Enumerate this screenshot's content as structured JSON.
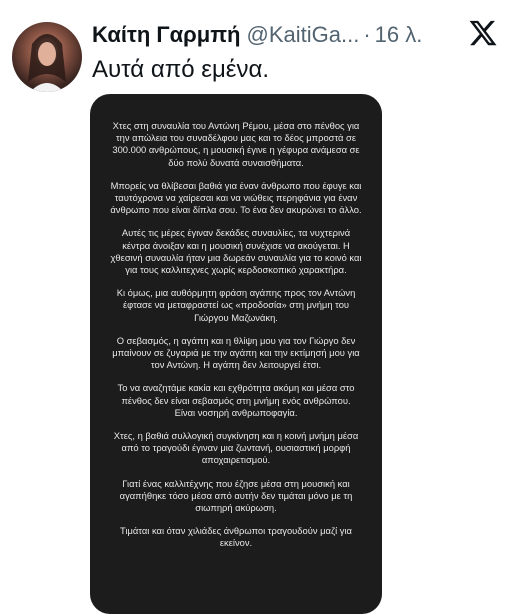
{
  "tweet": {
    "author_name": "Καίτη Γαρμπή",
    "author_handle": "@KaitiGa...",
    "separator": "·",
    "timestamp": "16 λ.",
    "text": "Αυτά από εμένα.",
    "logo_icon": "x-logo-icon"
  },
  "story": {
    "paragraphs": [
      "Χτες στη συναυλία του Αντώνη Ρέμου, μέσα στο πένθος για την απώλεια του συναδέλφου μας και το δέος μπροστά σε 300.000 ανθρώπους, η μουσική έγινε η γέφυρα ανάμεσα σε δύο πολύ δυνατά συναισθήματα.",
      "Μπορείς να θλίβεσαι βαθιά για έναν άνθρωπο που έφυγε και ταυτόχρονα να χαίρεσαι και να νιώθεις περηφάνια για έναν άνθρωπο που είναι δίπλα σου. Το ένα δεν ακυρώνει το άλλο.",
      "Αυτές τις μέρες έγιναν δεκάδες συναυλίες, τα νυχτερινά κέντρα άνοιξαν και η μουσική συνέχισε να ακούγεται. Η χθεσινή συναυλία ήταν μια δωρεάν συναυλία για το κοινό και για τους καλλιτεχνες χωρίς κερδοσκοπικό χαρακτήρα.",
      "Κι όμως, μια αυθόρμητη φράση αγάπης προς τον Αντώνη έφτασε να μεταφραστεί ως «προδοσία» στη μνήμη του Γιώργου Μαζωνάκη.",
      "Ο σεβασμός, η αγάπη και η θλίψη μου για τον Γιώργο δεν μπαίνουν σε ζυγαριά με την αγάπη και την εκτίμησή μου για τον Αντώνη. Η αγάπη δεν λειτουργεί έτσι.",
      "Το να αναζητάμε κακία και εχθρότητα ακόμη και μέσα στο πένθος δεν είναι σεβασμός στη μνήμη ενός ανθρώπου. Είναι νοσηρή ανθρωποφαγία.",
      "Χτες, η βαθιά συλλογική συγκίνηση και η κοινή μνήμη μέσα από το τραγούδι έγιναν μια ζωντανή, ουσιαστική μορφή αποχαιρετισμού.",
      "Γιατί ένας καλλιτέχνης που έζησε μέσα στη μουσική και αγαπήθηκε τόσο μέσα από αυτήν δεν τιμάται μόνο με τη σιωπηρή ακύρωση.",
      "Τιμάται και όταν χιλιάδες άνθρωποι τραγουδούν μαζί για εκείνον."
    ]
  }
}
